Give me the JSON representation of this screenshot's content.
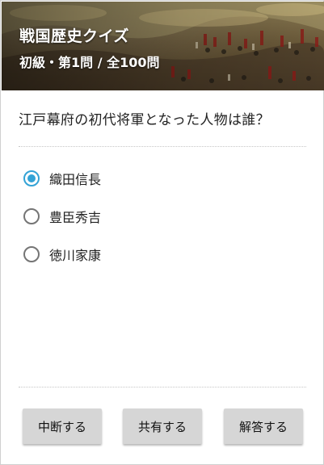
{
  "header": {
    "title": "戦国歴史クイズ",
    "subtitle": "初級・第1問 / 全100問"
  },
  "question": {
    "text": "江戸幕府の初代将軍となった人物は誰？"
  },
  "options": [
    {
      "label": "織田信長",
      "selected": true
    },
    {
      "label": "豊臣秀吉",
      "selected": false
    },
    {
      "label": "徳川家康",
      "selected": false
    }
  ],
  "buttons": {
    "pause": "中断する",
    "share": "共有する",
    "answer": "解答する"
  },
  "colors": {
    "accent": "#33a3d6",
    "button_bg": "#d6d6d6"
  }
}
